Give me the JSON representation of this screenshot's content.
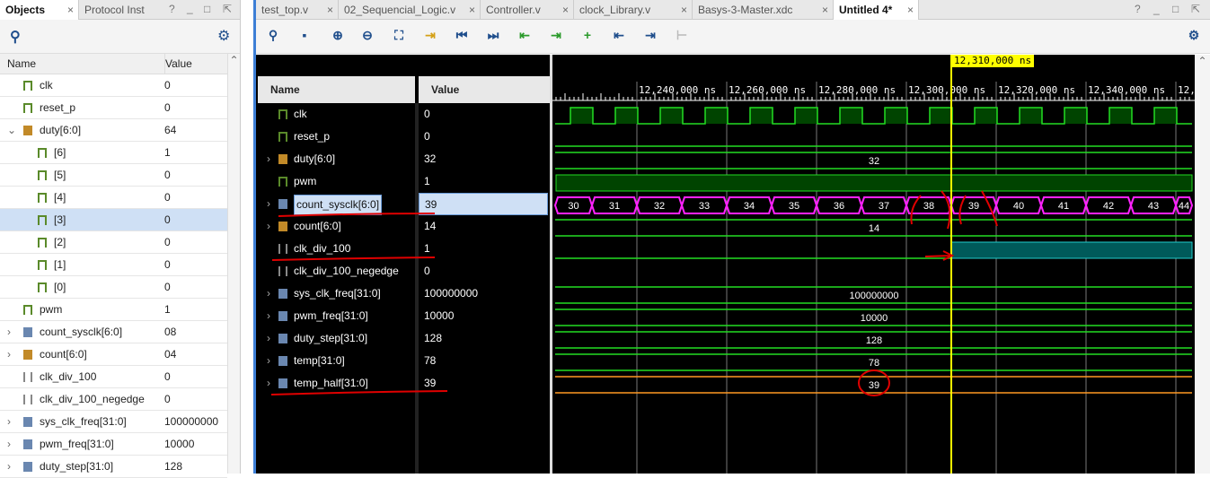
{
  "left_panel": {
    "tabs": [
      {
        "label": "Objects",
        "active": true
      },
      {
        "label": "Protocol Inst",
        "active": false
      }
    ],
    "window_controls": [
      "?",
      "_",
      "□",
      "⇱"
    ],
    "columns": [
      "Name",
      "Value"
    ],
    "rows": [
      {
        "name": "clk",
        "value": "0",
        "indent": 1,
        "icon": "bit"
      },
      {
        "name": "reset_p",
        "value": "0",
        "indent": 1,
        "icon": "bit"
      },
      {
        "name": "duty[6:0]",
        "value": "64",
        "indent": 1,
        "icon": "bus",
        "expand": "⌄"
      },
      {
        "name": "[6]",
        "value": "1",
        "indent": 2,
        "icon": "bit"
      },
      {
        "name": "[5]",
        "value": "0",
        "indent": 2,
        "icon": "bit"
      },
      {
        "name": "[4]",
        "value": "0",
        "indent": 2,
        "icon": "bit"
      },
      {
        "name": "[3]",
        "value": "0",
        "indent": 2,
        "icon": "bit",
        "selected": true
      },
      {
        "name": "[2]",
        "value": "0",
        "indent": 2,
        "icon": "bit"
      },
      {
        "name": "[1]",
        "value": "0",
        "indent": 2,
        "icon": "bit"
      },
      {
        "name": "[0]",
        "value": "0",
        "indent": 2,
        "icon": "bit"
      },
      {
        "name": "pwm",
        "value": "1",
        "indent": 1,
        "icon": "bit"
      },
      {
        "name": "count_sysclk[6:0]",
        "value": "08",
        "indent": 1,
        "icon": "blue",
        "expand": "›"
      },
      {
        "name": "count[6:0]",
        "value": "04",
        "indent": 1,
        "icon": "bus",
        "expand": "›"
      },
      {
        "name": "clk_div_100",
        "value": "0",
        "indent": 1,
        "icon": "grey"
      },
      {
        "name": "clk_div_100_negedge",
        "value": "0",
        "indent": 1,
        "icon": "grey"
      },
      {
        "name": "sys_clk_freq[31:0]",
        "value": "100000000",
        "indent": 1,
        "icon": "blue",
        "expand": "›"
      },
      {
        "name": "pwm_freq[31:0]",
        "value": "10000",
        "indent": 1,
        "icon": "blue",
        "expand": "›"
      },
      {
        "name": "duty_step[31:0]",
        "value": "128",
        "indent": 1,
        "icon": "blue",
        "expand": "›"
      }
    ]
  },
  "editor": {
    "tabs": [
      {
        "label": "test_top.v"
      },
      {
        "label": "02_Sequencial_Logic.v"
      },
      {
        "label": "Controller.v"
      },
      {
        "label": "clock_Library.v"
      },
      {
        "label": "Basys-3-Master.xdc"
      },
      {
        "label": "Untitled 4*",
        "active": true
      }
    ],
    "window_controls": [
      "?",
      "_",
      "□",
      "⇱"
    ]
  },
  "wave": {
    "columns": [
      "Name",
      "Value"
    ],
    "cursor_label": "12,310,000 ns",
    "time_labels": [
      "12,240,000 ns",
      "12,260,000 ns",
      "12,280,000 ns",
      "12,300,000 ns",
      "12,320,000 ns",
      "12,340,000 ns",
      "12,3"
    ],
    "signals": [
      {
        "name": "clk",
        "value": "0",
        "icon": "bit",
        "type": "clock"
      },
      {
        "name": "reset_p",
        "value": "0",
        "icon": "bit",
        "type": "low"
      },
      {
        "name": "duty[6:0]",
        "value": "32",
        "icon": "bus",
        "type": "bus",
        "bus_text": "32",
        "expand": "›"
      },
      {
        "name": "pwm",
        "value": "1",
        "icon": "bit",
        "type": "high"
      },
      {
        "name": "count_sysclk[6:0]",
        "value": "39",
        "icon": "blue",
        "type": "counter",
        "expand": "›",
        "selected": true
      },
      {
        "name": "count[6:0]",
        "value": "14",
        "icon": "bus",
        "type": "bus",
        "bus_text": "14",
        "expand": "›"
      },
      {
        "name": "clk_div_100",
        "value": "1",
        "icon": "grey",
        "type": "rise"
      },
      {
        "name": "clk_div_100_negedge",
        "value": "0",
        "icon": "grey",
        "type": "none"
      },
      {
        "name": "sys_clk_freq[31:0]",
        "value": "100000000",
        "icon": "blue",
        "type": "bus",
        "bus_text": "100000000",
        "expand": "›"
      },
      {
        "name": "pwm_freq[31:0]",
        "value": "10000",
        "icon": "blue",
        "type": "bus",
        "bus_text": "10000",
        "expand": "›"
      },
      {
        "name": "duty_step[31:0]",
        "value": "128",
        "icon": "blue",
        "type": "bus",
        "bus_text": "128",
        "expand": "›"
      },
      {
        "name": "temp[31:0]",
        "value": "78",
        "icon": "blue",
        "type": "bus",
        "bus_text": "78",
        "expand": "›"
      },
      {
        "name": "temp_half[31:0]",
        "value": "39",
        "icon": "blue",
        "type": "busorange",
        "bus_text": "39",
        "expand": "›"
      }
    ],
    "counter_values": [
      "30",
      "31",
      "32",
      "33",
      "34",
      "35",
      "36",
      "37",
      "38",
      "39",
      "40",
      "41",
      "42",
      "43",
      "44"
    ]
  },
  "colors": {
    "wave_green": "#22dd22",
    "counter": "#ff22ff",
    "cursor": "#ffff00",
    "annotation": "#e00000"
  }
}
